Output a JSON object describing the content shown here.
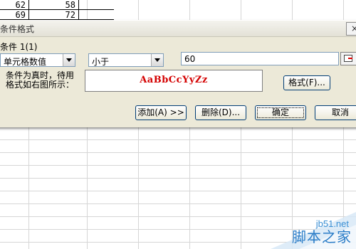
{
  "sheet": {
    "cells": [
      {
        "col": 0,
        "row": 0,
        "value": "62"
      },
      {
        "col": 1,
        "row": 0,
        "value": "58"
      },
      {
        "col": 0,
        "row": 1,
        "value": "69"
      },
      {
        "col": 1,
        "row": 1,
        "value": "72"
      }
    ]
  },
  "dialog": {
    "title": "条件格式",
    "close_label": "×",
    "condition_label": "条件 1(1)",
    "type_select": {
      "value": "单元格数值"
    },
    "operator_select": {
      "value": "小于"
    },
    "value_input": {
      "value": "60"
    },
    "description": [
      "条件为真时，待用",
      "格式如右图所示："
    ],
    "preview_text": "AaBbCcYyZz",
    "preview_color": "#d40000",
    "buttons": {
      "format": "格式(F)...",
      "add": "添加(A) >>",
      "delete": "删除(D)...",
      "ok": "确定",
      "cancel": "取消"
    }
  },
  "watermark": {
    "url": "jb51.net",
    "name": "脚本之家"
  }
}
